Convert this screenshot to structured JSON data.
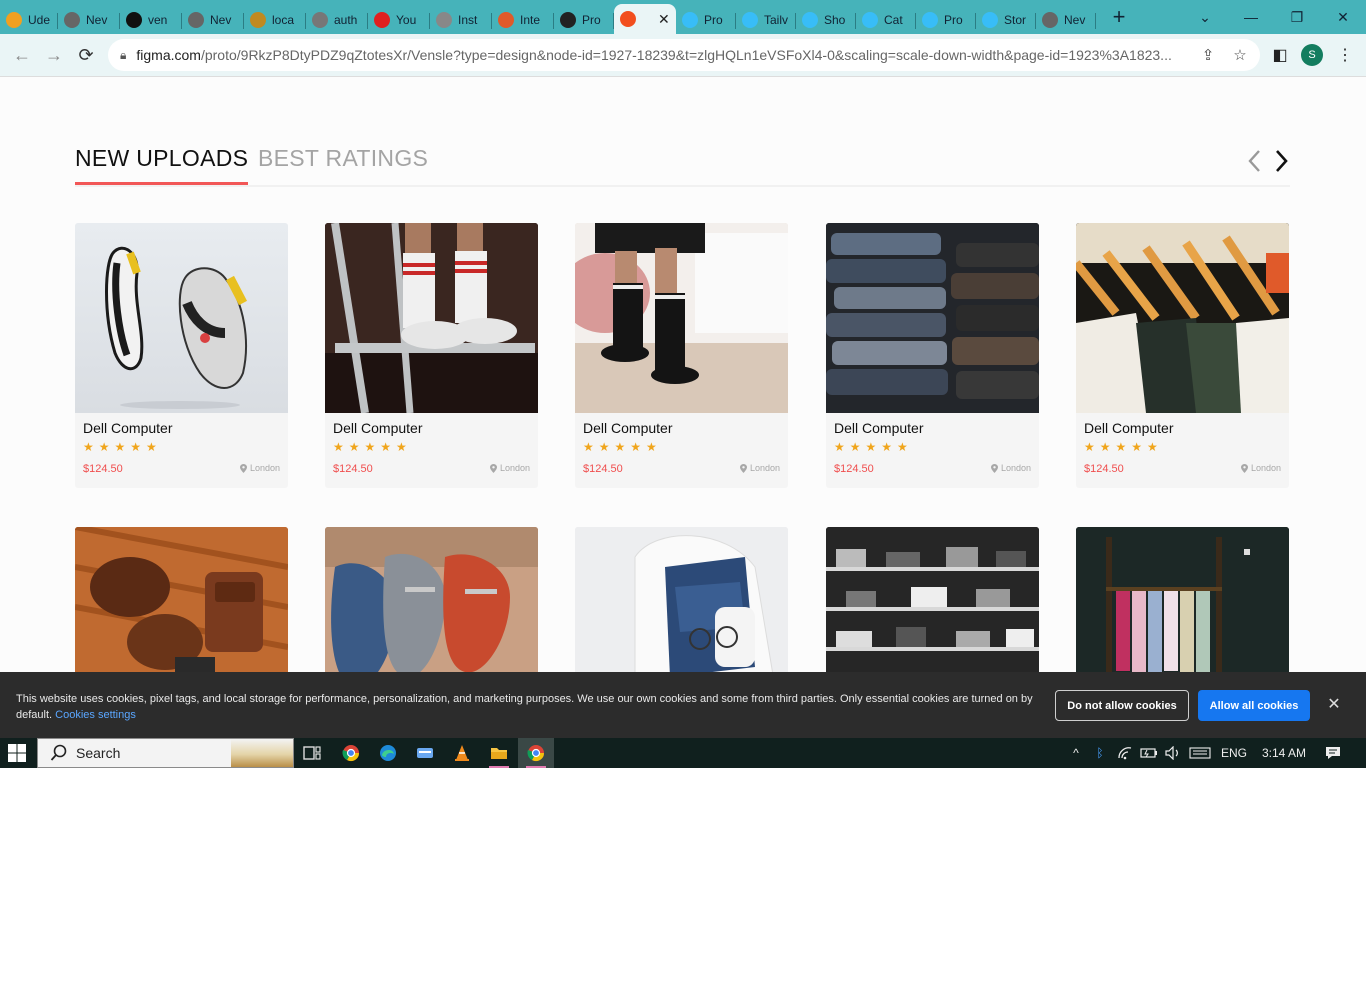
{
  "browser": {
    "tabs": [
      {
        "label": "Ude",
        "color": "#f0a020"
      },
      {
        "label": "Nev",
        "color": "#666666"
      },
      {
        "label": "ven",
        "color": "#111111"
      },
      {
        "label": "Nev",
        "color": "#666666"
      },
      {
        "label": "loca",
        "color": "#c08a20"
      },
      {
        "label": "auth",
        "color": "#777777"
      },
      {
        "label": "You",
        "color": "#e02020"
      },
      {
        "label": "Inst",
        "color": "#888888"
      },
      {
        "label": "Inte",
        "color": "#e05a2a"
      },
      {
        "label": "Pro",
        "color": "#222222"
      },
      {
        "label": "",
        "color": "#f24e1e",
        "active": true
      },
      {
        "label": "Pro",
        "color": "#38bdf8"
      },
      {
        "label": "Tailv",
        "color": "#38bdf8"
      },
      {
        "label": "Sho",
        "color": "#38bdf8"
      },
      {
        "label": "Cat",
        "color": "#38bdf8"
      },
      {
        "label": "Pro",
        "color": "#38bdf8"
      },
      {
        "label": "Stor",
        "color": "#38bdf8"
      },
      {
        "label": "Nev",
        "color": "#666666"
      }
    ],
    "new_tab": "+",
    "url_main": "figma.com",
    "url_rest": "/proto/9RkzP8DtyPDZ9qZtotesXr/Vensle?type=design&node-id=1927-18239&t=zlgHQLn1eVSFoXl4-0&scaling=scale-down-width&page-id=1923%3A1823...",
    "profile_initial": "S"
  },
  "section": {
    "tab_active": "NEW UPLOADS",
    "tab_inactive": "BEST RATINGS"
  },
  "products_row1": [
    {
      "title": "Dell Computer",
      "stars": "★★★★★",
      "price": "$124.50",
      "location": "London",
      "image": "sneakers"
    },
    {
      "title": "Dell Computer",
      "stars": "★★★★★",
      "price": "$124.50",
      "location": "London",
      "image": "socks-ladder"
    },
    {
      "title": "Dell Computer",
      "stars": "★★★★★",
      "price": "$124.50",
      "location": "London",
      "image": "boots"
    },
    {
      "title": "Dell Computer",
      "stars": "★★★★★",
      "price": "$124.50",
      "location": "London",
      "image": "jeans-stack"
    },
    {
      "title": "Dell Computer",
      "stars": "★★★★★",
      "price": "$124.50",
      "location": "London",
      "image": "hangers"
    }
  ],
  "products_row2": [
    {
      "image": "brown-shoes-wallet"
    },
    {
      "image": "loafers"
    },
    {
      "image": "folded-clothes"
    },
    {
      "image": "shelves"
    },
    {
      "image": "clothing-rack"
    }
  ],
  "cookie": {
    "text": "This website uses cookies, pixel tags, and local storage for performance, personalization, and marketing purposes. We use our own cookies and some from third parties. Only essential cookies are turned on by default.",
    "settings_link": "Cookies settings",
    "deny_label": "Do not allow cookies",
    "allow_label": "Allow all cookies"
  },
  "taskbar": {
    "search_label": "Search",
    "language": "ENG",
    "time": "3:14 AM"
  },
  "colors": {
    "accent": "#f25757",
    "star": "#f0a51c",
    "price": "#f04e4e",
    "allow_button": "#1677f0"
  }
}
